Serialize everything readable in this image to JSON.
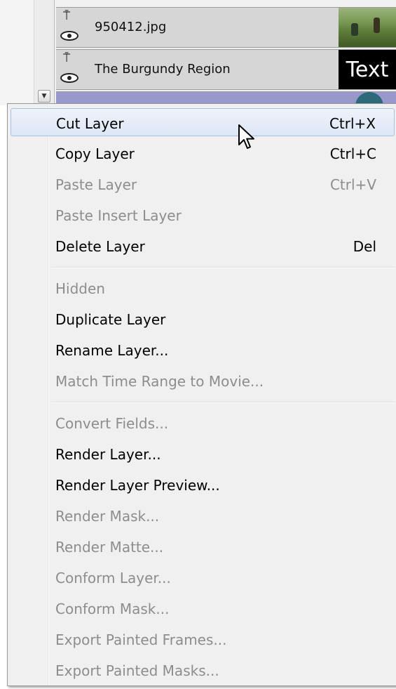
{
  "layers": [
    {
      "name": "950412.jpg"
    },
    {
      "name": "The Burgundy Region",
      "thumb_text": "Text"
    }
  ],
  "scroll_down_glyph": "▼",
  "menu": {
    "items": [
      {
        "label": "Cut Layer",
        "shortcut": "Ctrl+X",
        "enabled": true,
        "hover": true
      },
      {
        "label": "Copy Layer",
        "shortcut": "Ctrl+C",
        "enabled": true
      },
      {
        "label": "Paste Layer",
        "shortcut": "Ctrl+V",
        "enabled": false
      },
      {
        "label": "Paste Insert Layer",
        "shortcut": "",
        "enabled": false
      },
      {
        "label": "Delete Layer",
        "shortcut": "Del",
        "enabled": true
      },
      {
        "label": "Hidden",
        "shortcut": "",
        "enabled": false
      },
      {
        "label": "Duplicate Layer",
        "shortcut": "",
        "enabled": true
      },
      {
        "label": "Rename Layer...",
        "shortcut": "",
        "enabled": true
      },
      {
        "label": "Match Time Range to Movie...",
        "shortcut": "",
        "enabled": false
      },
      {
        "label": "Convert Fields...",
        "shortcut": "",
        "enabled": false
      },
      {
        "label": "Render Layer...",
        "shortcut": "",
        "enabled": true
      },
      {
        "label": "Render Layer Preview...",
        "shortcut": "",
        "enabled": true
      },
      {
        "label": "Render Mask...",
        "shortcut": "",
        "enabled": false
      },
      {
        "label": "Render Matte...",
        "shortcut": "",
        "enabled": false
      },
      {
        "label": "Conform Layer...",
        "shortcut": "",
        "enabled": false
      },
      {
        "label": "Conform Mask...",
        "shortcut": "",
        "enabled": false
      },
      {
        "label": "Export Painted Frames...",
        "shortcut": "",
        "enabled": false
      },
      {
        "label": "Export Painted Masks...",
        "shortcut": "",
        "enabled": false
      }
    ]
  },
  "colors": {
    "selected_layer_row": "#9898cc",
    "menu_disabled_text": "#8d8d8d",
    "menu_hover": "#dde7f5"
  }
}
